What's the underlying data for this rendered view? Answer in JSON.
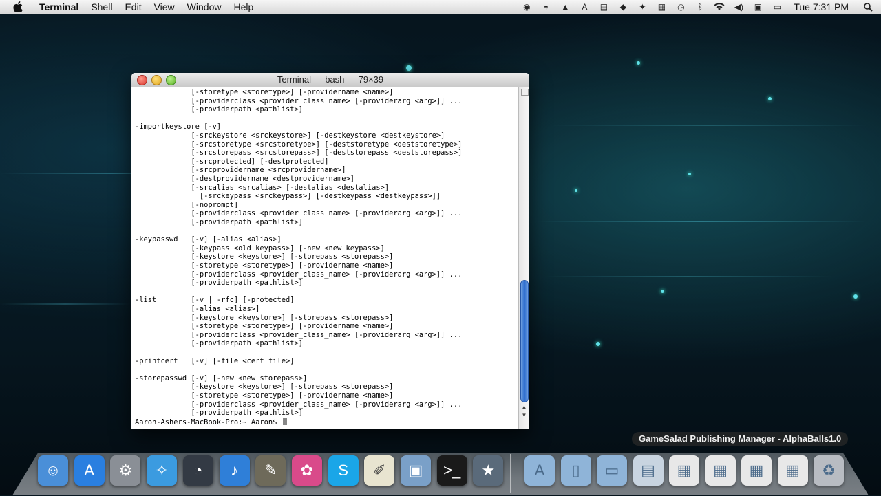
{
  "menubar": {
    "app_name": "Terminal",
    "menus": [
      "Shell",
      "Edit",
      "View",
      "Window",
      "Help"
    ],
    "clock": "Tue 7:31 PM"
  },
  "terminal": {
    "title": "Terminal — bash — 79×39",
    "lines": [
      "             [-storetype <storetype>] [-providername <name>]",
      "             [-providerclass <provider_class_name> [-providerarg <arg>]] ...",
      "             [-providerpath <pathlist>]",
      "",
      "-importkeystore [-v]",
      "             [-srckeystore <srckeystore>] [-destkeystore <destkeystore>]",
      "             [-srcstoretype <srcstoretype>] [-deststoretype <deststoretype>]",
      "             [-srcstorepass <srcstorepass>] [-deststorepass <deststorepass>]",
      "             [-srcprotected] [-destprotected]",
      "             [-srcprovidername <srcprovidername>]",
      "             [-destprovidername <destprovidername>]",
      "             [-srcalias <srcalias> [-destalias <destalias>]",
      "               [-srckeypass <srckeypass>] [-destkeypass <destkeypass>]]",
      "             [-noprompt]",
      "             [-providerclass <provider_class_name> [-providerarg <arg>]] ...",
      "             [-providerpath <pathlist>]",
      "",
      "-keypasswd   [-v] [-alias <alias>]",
      "             [-keypass <old_keypass>] [-new <new_keypass>]",
      "             [-keystore <keystore>] [-storepass <storepass>]",
      "             [-storetype <storetype>] [-providername <name>]",
      "             [-providerclass <provider_class_name> [-providerarg <arg>]] ...",
      "             [-providerpath <pathlist>]",
      "",
      "-list        [-v | -rfc] [-protected]",
      "             [-alias <alias>]",
      "             [-keystore <keystore>] [-storepass <storepass>]",
      "             [-storetype <storetype>] [-providername <name>]",
      "             [-providerclass <provider_class_name> [-providerarg <arg>]] ...",
      "             [-providerpath <pathlist>]",
      "",
      "-printcert   [-v] [-file <cert_file>]",
      "",
      "-storepasswd [-v] [-new <new_storepass>]",
      "             [-keystore <keystore>] [-storepass <storepass>]",
      "             [-storetype <storetype>] [-providername <name>]",
      "             [-providerclass <provider_class_name> [-providerarg <arg>]] ...",
      "             [-providerpath <pathlist>]"
    ],
    "prompt": "Aaron-Ashers-MacBook-Pro:~ Aaron$ "
  },
  "dock": {
    "hover_label": "GameSalad Publishing Manager - AlphaBalls1.0",
    "apps": [
      {
        "name": "finder-icon",
        "color": "#4a8fd8"
      },
      {
        "name": "app-store-icon",
        "color": "#2a7fe0"
      },
      {
        "name": "system-preferences-icon",
        "color": "#8a8f96"
      },
      {
        "name": "safari-icon",
        "color": "#3b9be0"
      },
      {
        "name": "dashboard-icon",
        "color": "#333a44"
      },
      {
        "name": "itunes-icon",
        "color": "#2f7fd8"
      },
      {
        "name": "gimp-icon",
        "color": "#6e6a5a"
      },
      {
        "name": "gamesalad-icon",
        "color": "#d94a8a"
      },
      {
        "name": "skype-icon",
        "color": "#1aa6e8"
      },
      {
        "name": "textedit-icon",
        "color": "#e8e4d0"
      },
      {
        "name": "preview-icon",
        "color": "#7aa0c8"
      },
      {
        "name": "terminal-icon",
        "color": "#1a1a1a"
      },
      {
        "name": "imovie-icon",
        "color": "#5a6a7a"
      }
    ],
    "stacks": [
      {
        "name": "applications-stack-icon",
        "color": "#8fb4d8"
      },
      {
        "name": "documents-stack-icon",
        "color": "#8fb4d8"
      },
      {
        "name": "desktop-stack-icon",
        "color": "#8fb4d8"
      },
      {
        "name": "downloads-stack-icon",
        "color": "#c8d4e0"
      },
      {
        "name": "window-thumbnail-icon",
        "color": "#e8e8e8"
      },
      {
        "name": "window-thumbnail-icon",
        "color": "#e8e8e8"
      },
      {
        "name": "window-thumbnail-icon",
        "color": "#e8e8e8"
      },
      {
        "name": "window-thumbnail-icon",
        "color": "#e8e8e8"
      },
      {
        "name": "trash-icon",
        "color": "#b8bcc2"
      }
    ]
  }
}
